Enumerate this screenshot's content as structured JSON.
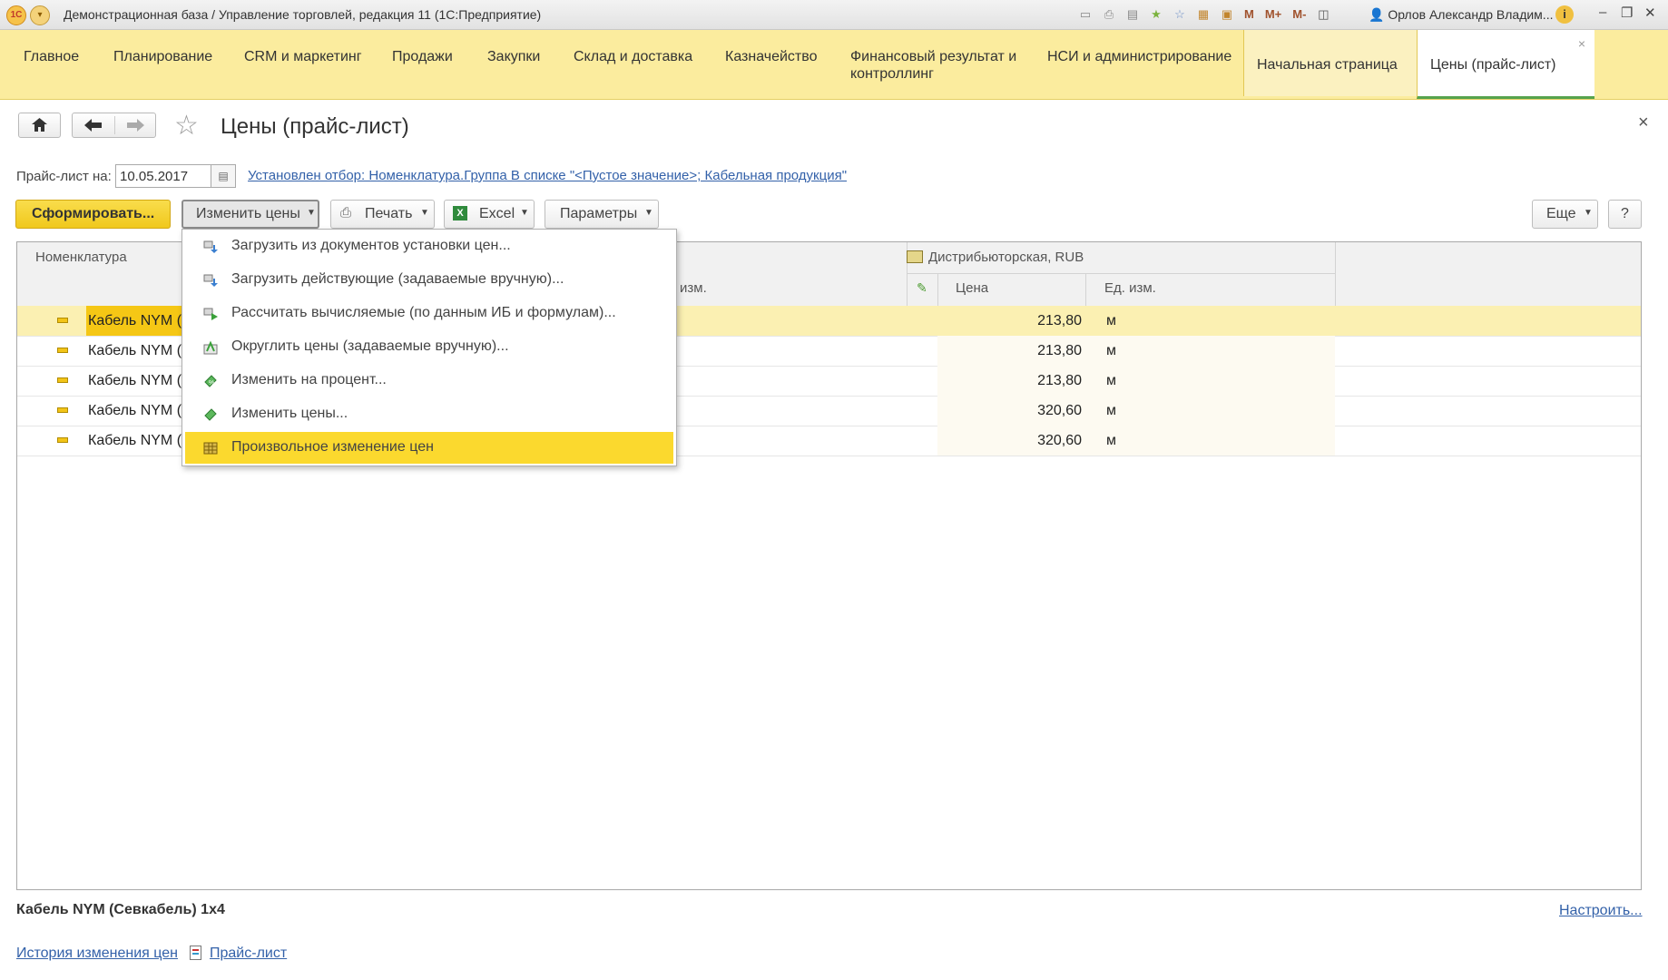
{
  "window": {
    "title": "Демонстрационная база / Управление торговлей, редакция 11  (1С:Предприятие)",
    "logo_text": "1С",
    "memory_buttons": [
      "M",
      "M+",
      "M-"
    ],
    "user": "Орлов Александр Владим...",
    "icons": [
      "save-icon",
      "print-icon",
      "preview-icon",
      "favorites-icon",
      "history-icon",
      "calculator-icon",
      "calendar-icon",
      "panels-icon",
      "user-icon",
      "info-icon"
    ]
  },
  "sections": [
    {
      "label": "Главное"
    },
    {
      "label": "Планирование"
    },
    {
      "label": "CRM и маркетинг"
    },
    {
      "label": "Продажи"
    },
    {
      "label": "Закупки"
    },
    {
      "label": "Склад и доставка"
    },
    {
      "label": "Казначейство"
    },
    {
      "label": "Финансовый результат и контроллинг"
    },
    {
      "label": "НСИ и администрирование"
    }
  ],
  "tabs": {
    "home": "Начальная страница",
    "active": "Цены (прайс-лист)",
    "close_glyph": "×"
  },
  "form": {
    "title": "Цены (прайс-лист)",
    "close_glyph": "×",
    "date_label": "Прайс-лист на:",
    "date_value": "10.05.2017",
    "filter_text": "Установлен отбор: Номенклатура.Группа В списке \"<Пустое значение>; Кабельная продукция\""
  },
  "toolbar": {
    "generate": "Сформировать...",
    "change_prices": "Изменить цены",
    "print": "Печать",
    "excel": "Excel",
    "params": "Параметры",
    "more": "Еще",
    "help": "?"
  },
  "table": {
    "col_nomenclature": "Номенклатура",
    "col_unit_partial": "изм.",
    "group_header": "Дистрибьюторская, RUB",
    "col_price": "Цена",
    "col_unit": "Ед. изм.",
    "rows": [
      {
        "name": "Кабель NYM (С",
        "price": "213,80",
        "unit": "м",
        "selected": true
      },
      {
        "name": "Кабель NYM (С",
        "price": "213,80",
        "unit": "м",
        "selected": false
      },
      {
        "name": "Кабель NYM (С",
        "price": "213,80",
        "unit": "м",
        "selected": false
      },
      {
        "name": "Кабель NYM (С",
        "price": "320,60",
        "unit": "м",
        "selected": false
      },
      {
        "name": "Кабель NYM (С",
        "price": "320,60",
        "unit": "м",
        "selected": false
      }
    ]
  },
  "dropdown": {
    "items": [
      {
        "label": "Загрузить из документов установки цен...",
        "icon": "load-from-documents-icon"
      },
      {
        "label": "Загрузить действующие (задаваемые вручную)...",
        "icon": "load-current-icon"
      },
      {
        "label": "Рассчитать вычисляемые (по данным ИБ и формулам)...",
        "icon": "calculate-icon"
      },
      {
        "label": "Округлить цены (задаваемые вручную)...",
        "icon": "round-icon"
      },
      {
        "label": "Изменить на процент...",
        "icon": "percent-change-icon"
      },
      {
        "label": "Изменить цены...",
        "icon": "edit-prices-icon"
      },
      {
        "label": "Произвольное изменение цен",
        "icon": "grid-icon",
        "highlighted": true
      }
    ]
  },
  "footer": {
    "selected_item": "Кабель NYM (Севкабель) 1х4",
    "configure": "Настроить...",
    "history_link": "История изменения цен",
    "pricelist_link": "Прайс-лист"
  },
  "colors": {
    "sections_bg": "#fbec9e",
    "primary_button": "#f5cf2a",
    "selected_row": "#fbf0b2",
    "menu_highlight": "#fbd92e",
    "link": "#3361a9"
  }
}
